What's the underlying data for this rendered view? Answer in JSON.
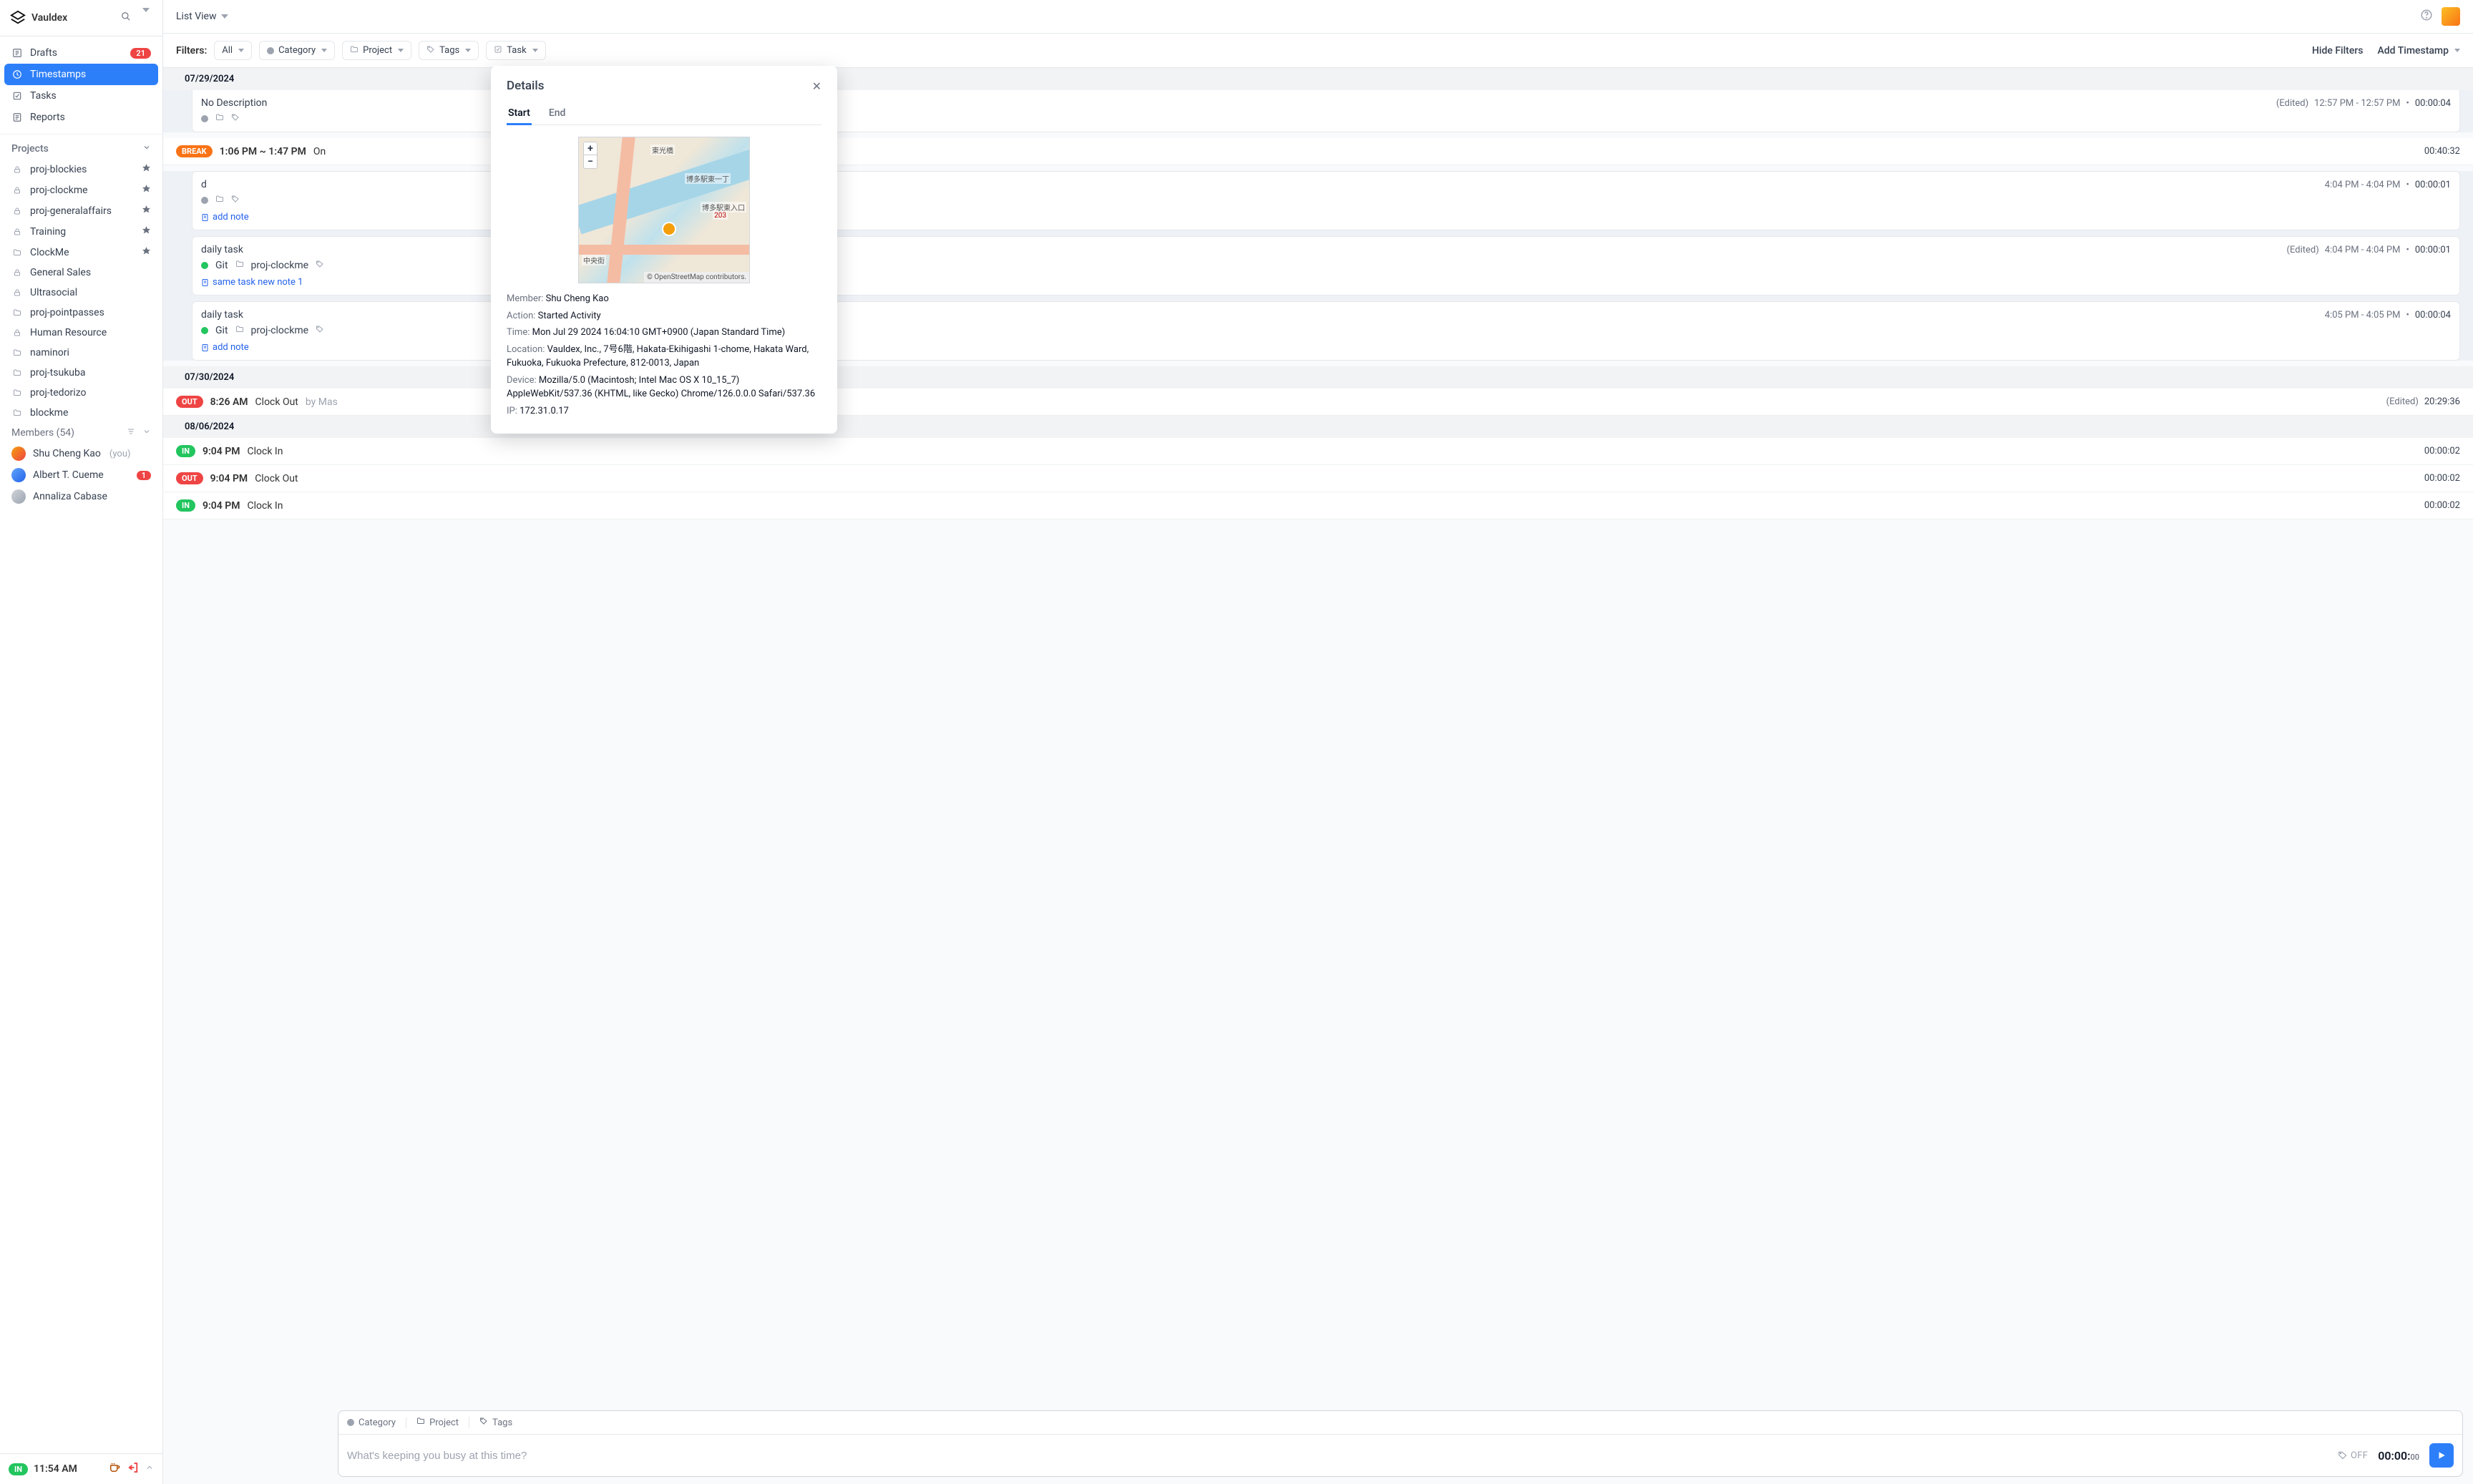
{
  "brand": "Vauldex",
  "top": {
    "view": "List View"
  },
  "sidebar": {
    "nav": [
      {
        "label": "Drafts",
        "badge": "21"
      },
      {
        "label": "Timestamps",
        "active": true
      },
      {
        "label": "Tasks"
      },
      {
        "label": "Reports"
      }
    ],
    "projects_header": "Projects",
    "projects": [
      {
        "label": "proj-blockies",
        "icon": "lock",
        "star": true
      },
      {
        "label": "proj-clockme",
        "icon": "lock",
        "star": true
      },
      {
        "label": "proj-generalaffairs",
        "icon": "lock",
        "star": true
      },
      {
        "label": "Training",
        "icon": "lock",
        "star": true
      },
      {
        "label": "ClockMe",
        "icon": "folder",
        "star": true
      },
      {
        "label": "General Sales",
        "icon": "lock"
      },
      {
        "label": "Ultrasocial",
        "icon": "lock"
      },
      {
        "label": "proj-pointpasses",
        "icon": "folder"
      },
      {
        "label": "Human Resource",
        "icon": "lock"
      },
      {
        "label": "naminori",
        "icon": "folder"
      },
      {
        "label": "proj-tsukuba",
        "icon": "folder"
      },
      {
        "label": "proj-tedorizo",
        "icon": "folder"
      },
      {
        "label": "blockme",
        "icon": "folder"
      }
    ],
    "members_header": "Members (54)",
    "members": [
      {
        "name": "Shu Cheng Kao",
        "you": "(you)",
        "av": "a"
      },
      {
        "name": "Albert T. Cueme",
        "badge": "1",
        "av": "b"
      },
      {
        "name": "Annaliza Cabase",
        "av": "g"
      }
    ]
  },
  "footer": {
    "status": "IN",
    "time": "11:54 AM"
  },
  "filters": {
    "label": "Filters:",
    "chips": [
      "All",
      "Category",
      "Project",
      "Tags",
      "Task"
    ],
    "hide": "Hide Filters",
    "add": "Add Timestamp"
  },
  "dates": {
    "d1": "07/29/2024",
    "d2": "07/30/2024",
    "d3": "08/06/2024"
  },
  "items": {
    "nodesc": {
      "title": "No Description",
      "edited": "(Edited)",
      "span": "12:57 PM  -   12:57 PM",
      "dur": "00:00:04"
    },
    "break": {
      "pill": "BREAK",
      "range": "1:06 PM ~ 1:47 PM",
      "title": "On",
      "dur": "00:40:32"
    },
    "d_card": {
      "title": "d",
      "note": "add note",
      "span": "4:04 PM  -   4:04 PM",
      "dur": "00:00:01"
    },
    "daily1": {
      "title": "daily task",
      "cat": "Git",
      "proj": "proj-clockme",
      "note": "same task new note 1",
      "edited": "(Edited)",
      "span": "4:04 PM  -   4:04 PM",
      "dur": "00:00:01"
    },
    "daily2": {
      "title": "daily task",
      "cat": "Git",
      "proj": "proj-clockme",
      "note": "add note",
      "span": "4:05 PM  -   4:05 PM",
      "dur": "00:00:04"
    },
    "out826": {
      "pill": "OUT",
      "time": "8:26 AM",
      "title": "Clock Out",
      "by": "by Mas",
      "edited": "(Edited)",
      "dur": "20:29:36"
    },
    "in904": {
      "pill": "IN",
      "time": "9:04 PM",
      "title": "Clock In",
      "dur": "00:00:02"
    },
    "out904": {
      "pill": "OUT",
      "time": "9:04 PM",
      "title": "Clock Out",
      "dur": "00:00:02"
    },
    "in904b": {
      "pill": "IN",
      "time": "9:04 PM",
      "title": "Clock In",
      "dur": "00:00:02"
    }
  },
  "compose": {
    "chips": {
      "cat": "Category",
      "proj": "Project",
      "tags": "Tags"
    },
    "placeholder": "What's keeping you busy at this time?",
    "off": "OFF",
    "timer": "00:00:",
    "timer_ms": "00"
  },
  "modal": {
    "title": "Details",
    "tabs": {
      "start": "Start",
      "end": "End"
    },
    "map": {
      "labels": {
        "a": "東光橋",
        "b": "博多駅東一丁",
        "c": "博多駅東入口",
        "d": "203",
        "e": "中央街"
      },
      "credit": "© OpenStreetMap contributors.",
      "plus": "+",
      "minus": "−"
    },
    "info": {
      "member_k": "Member: ",
      "member_v": "Shu Cheng Kao",
      "action_k": "Action: ",
      "action_v": "Started Activity",
      "time_k": "Time: ",
      "time_v": "Mon Jul 29 2024 16:04:10 GMT+0900 (Japan Standard Time)",
      "loc_k": "Location: ",
      "loc_v": "Vauldex, Inc., 7号6階, Hakata-Ekihigashi 1-chome, Hakata Ward, Fukuoka, Fukuoka Prefecture, 812-0013, Japan",
      "device_k": "Device: ",
      "device_v": "Mozilla/5.0 (Macintosh; Intel Mac OS X 10_15_7) AppleWebKit/537.36 (KHTML, like Gecko) Chrome/126.0.0.0 Safari/537.36",
      "ip_k": "IP: ",
      "ip_v": "172.31.0.17"
    }
  }
}
